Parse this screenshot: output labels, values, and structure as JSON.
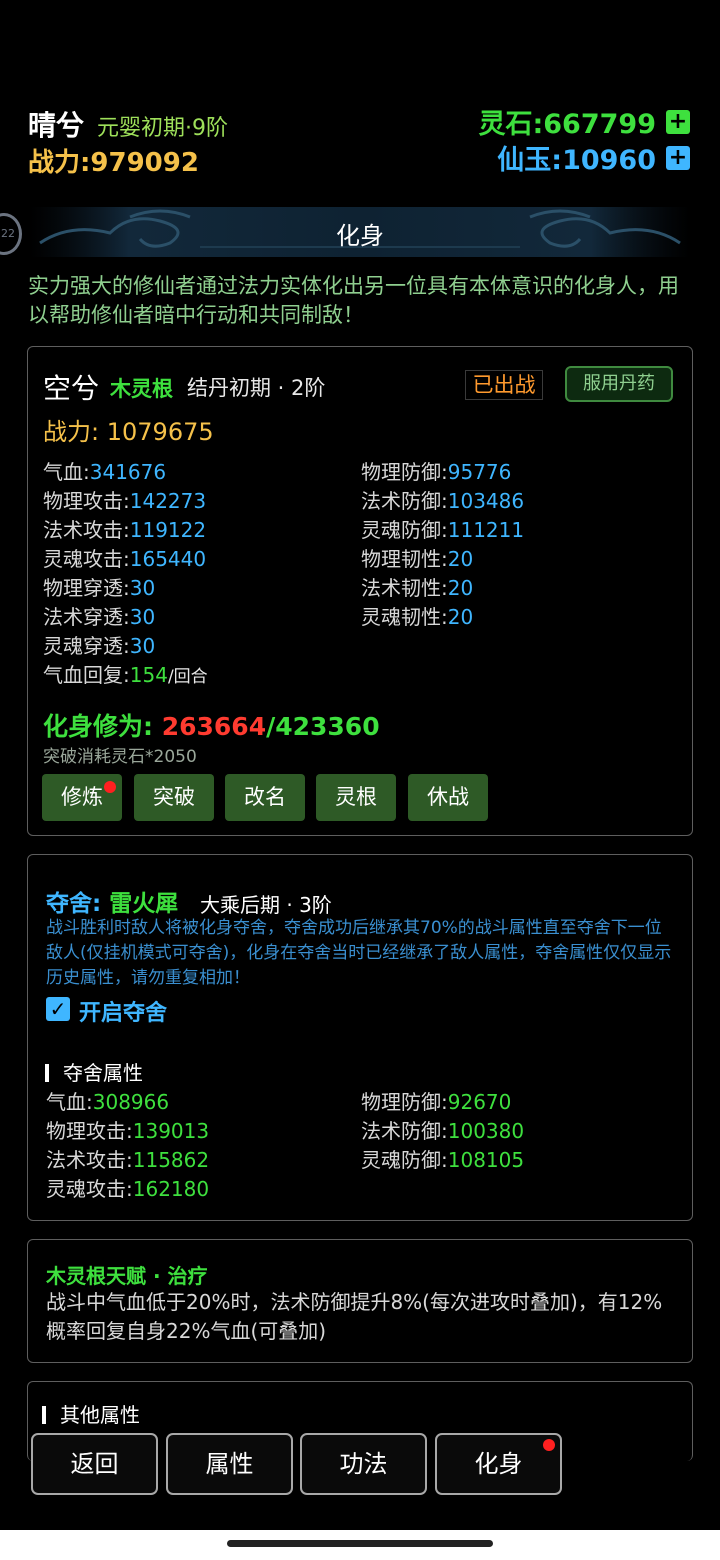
{
  "header": {
    "player_name": "晴兮",
    "player_realm": "元婴初期·9阶",
    "power_label": "战力:",
    "power_value": "979092",
    "spirit_stone_label": "灵石:",
    "spirit_stone_value": "667799",
    "jade_label": "仙玉:",
    "jade_value": "10960",
    "plus_icon": "+"
  },
  "banner": {
    "title": "化身",
    "badge": "22"
  },
  "intro": "实力强大的修仙者通过法力实体化出另一位具有本体意识的化身人，用以帮助修仙者暗中行动和共同制敌！",
  "avatar_card": {
    "name": "空兮",
    "root": "木灵根",
    "realm": "结丹初期 · 2阶",
    "status": "已出战",
    "take_pill_label": "服用丹药",
    "power_label": "战力:",
    "power_value": "1079675",
    "stats_left": [
      {
        "label": "气血:",
        "value": "341676"
      },
      {
        "label": "物理攻击:",
        "value": "142273"
      },
      {
        "label": "法术攻击:",
        "value": "119122"
      },
      {
        "label": "灵魂攻击:",
        "value": "165440"
      },
      {
        "label": "物理穿透:",
        "value": "30"
      },
      {
        "label": "法术穿透:",
        "value": "30"
      },
      {
        "label": "灵魂穿透:",
        "value": "30"
      },
      {
        "label": "气血回复:",
        "value": "154",
        "unit": "/回合"
      }
    ],
    "stats_right": [
      {
        "label": "物理防御:",
        "value": "95776"
      },
      {
        "label": "法术防御:",
        "value": "103486"
      },
      {
        "label": "灵魂防御:",
        "value": "111211"
      },
      {
        "label": "物理韧性:",
        "value": "20"
      },
      {
        "label": "法术韧性:",
        "value": "20"
      },
      {
        "label": "灵魂韧性:",
        "value": "20"
      }
    ],
    "cultivation_label": "化身修为:",
    "cultivation_current": "263664",
    "cultivation_sep_max": "/423360",
    "breakthrough_cost": "突破消耗灵石*2050",
    "actions": [
      "修炼",
      "突破",
      "改名",
      "灵根",
      "休战"
    ]
  },
  "possess_card": {
    "label": "夺舍:",
    "monster": "雷火犀",
    "realm": "大乘后期 · 3阶",
    "description": "战斗胜利时敌人将被化身夺舍，夺舍成功后继承其70%的战斗属性直至夺舍下一位敌人(仅挂机模式可夺舍)，化身在夺舍当时已经继承了敌人属性，夺舍属性仅仅显示历史属性，请勿重复相加！",
    "toggle_label": "开启夺舍",
    "toggle_checked": true,
    "section_title": "夺舍属性",
    "stats_left": [
      {
        "label": "气血:",
        "value": "308966"
      },
      {
        "label": "物理攻击:",
        "value": "139013"
      },
      {
        "label": "法术攻击:",
        "value": "115862"
      },
      {
        "label": "灵魂攻击:",
        "value": "162180"
      }
    ],
    "stats_right": [
      {
        "label": "物理防御:",
        "value": "92670"
      },
      {
        "label": "法术防御:",
        "value": "100380"
      },
      {
        "label": "灵魂防御:",
        "value": "108105"
      }
    ]
  },
  "talent_card": {
    "title": "木灵根天赋 · 治疗",
    "description": "战斗中气血低于20%时，法术防御提升8%(每次进攻时叠加)，有12%概率回复自身22%气血(可叠加)"
  },
  "other_card": {
    "title": "其他属性"
  },
  "bottom_nav": [
    "返回",
    "属性",
    "功法",
    "化身"
  ],
  "colors": {
    "green": "#3ee03e",
    "blue": "#3fb6ff",
    "gold": "#f5c14a",
    "orange": "#ff9a2e",
    "red": "#ff3b30",
    "button_green": "#2e5a26"
  }
}
